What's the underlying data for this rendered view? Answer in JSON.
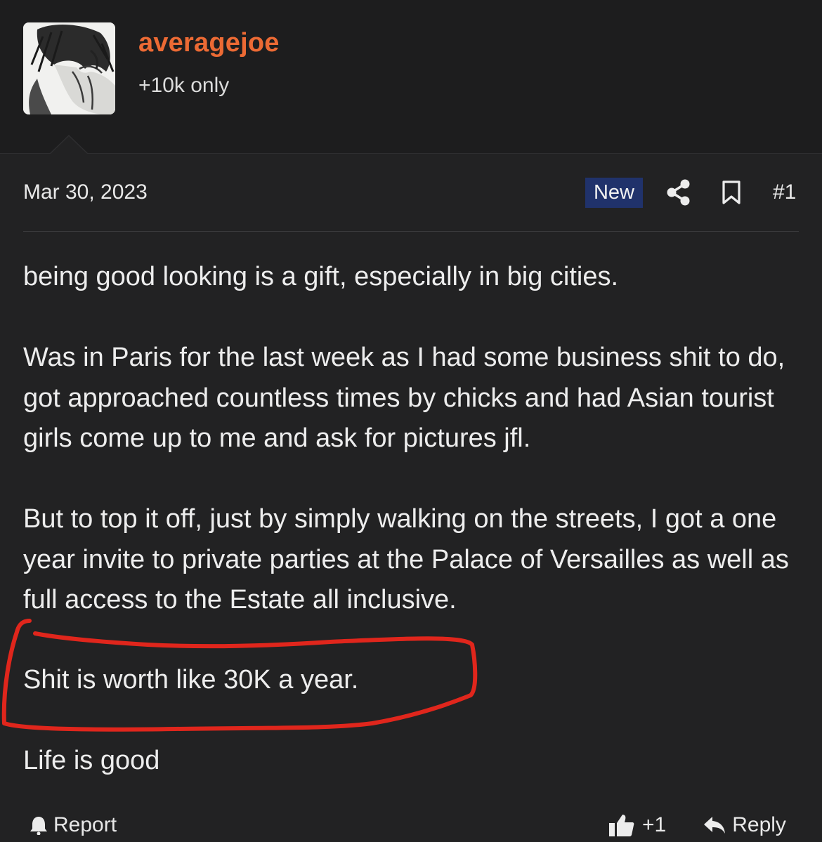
{
  "user": {
    "name": "averagejoe",
    "title": "+10k only"
  },
  "post": {
    "date": "Mar 30, 2023",
    "badge": "New",
    "number": "#1",
    "paragraphs": [
      "being good looking is a gift, especially in big cities.",
      "Was in Paris for the last week as I had some business shit to do, got approached countless times by chicks and had Asian tourist girls come up to me and ask for pictures jfl.",
      "But to top it off, just by simply walking on the streets, I got a one year invite to private parties at the Palace of Versailles as well as full access to the Estate all inclusive.",
      "Shit is worth like 30K a year.",
      "Life is good"
    ]
  },
  "actions": {
    "report": "Report",
    "like_count": "+1",
    "reply": "Reply"
  },
  "colors": {
    "username": "#ec6a34",
    "badge_bg": "#20326b",
    "annotation": "#e0261c",
    "background": "#222223"
  },
  "icons": [
    "share-icon",
    "bookmark-icon",
    "report-icon",
    "thumbs-up-icon",
    "reply-icon"
  ]
}
